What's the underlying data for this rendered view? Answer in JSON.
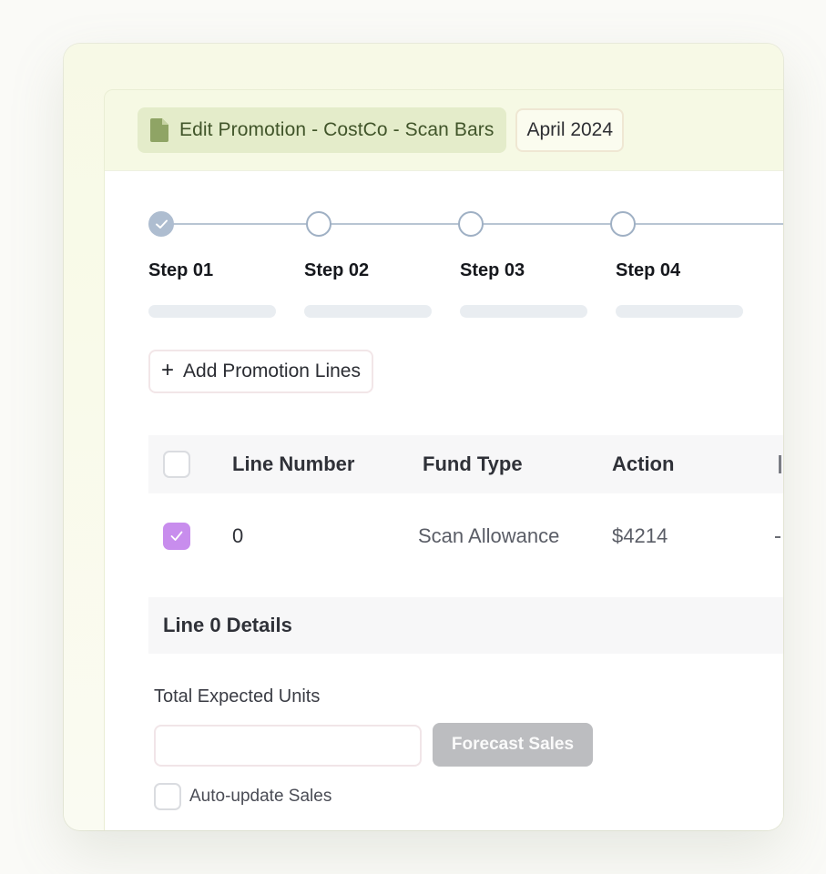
{
  "header": {
    "title": "Edit Promotion - CostCo - Scan Bars",
    "title_icon": "file-icon",
    "period": "April 2024"
  },
  "stepper": {
    "steps": [
      {
        "label": "Step 01",
        "completed": true
      },
      {
        "label": "Step 02",
        "completed": false
      },
      {
        "label": "Step 03",
        "completed": false
      },
      {
        "label": "Step 04",
        "completed": false
      }
    ]
  },
  "actions": {
    "add_lines_icon": "+",
    "add_lines_label": "Add Promotion Lines"
  },
  "table": {
    "columns": [
      "Line Number",
      "Fund Type",
      "Action"
    ],
    "rows": [
      {
        "selected": true,
        "line_number": "0",
        "fund_type": "Scan Allowance",
        "action": "$4214"
      }
    ]
  },
  "details": {
    "title": "Line 0 Details",
    "units_label": "Total Expected Units",
    "units_value": "",
    "forecast_button": "Forecast Sales",
    "auto_update_label": "Auto-update Sales",
    "auto_update_checked": false
  },
  "colors": {
    "accent_checkbox": "#c88ded",
    "title_pill_bg": "#e4ecca",
    "title_text": "#41552a",
    "step_done": "#aebdd0",
    "disabled_button": "#bcbdc0"
  }
}
